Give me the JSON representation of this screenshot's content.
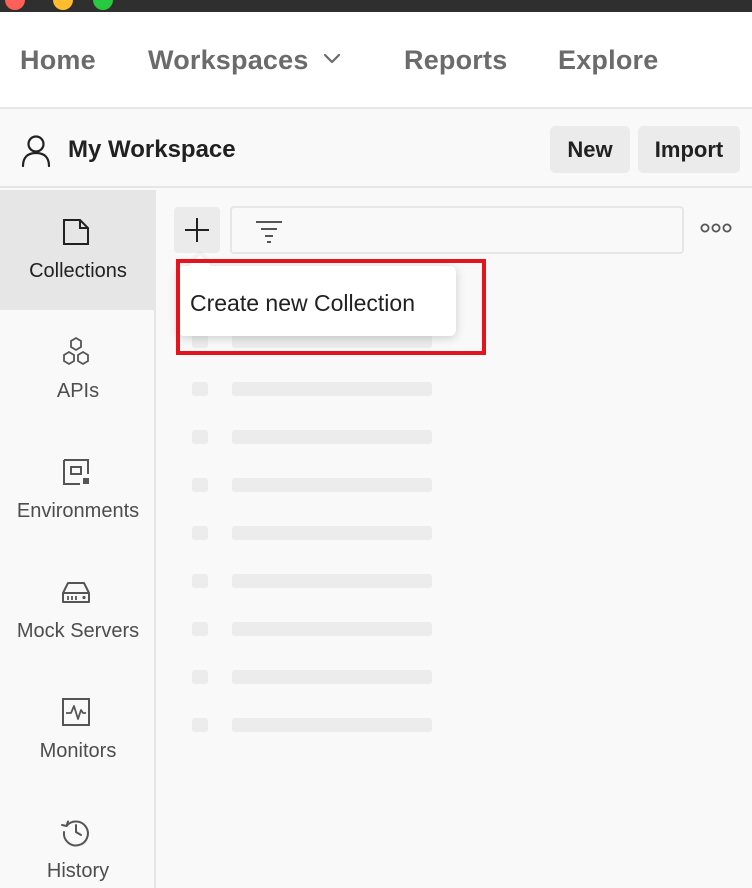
{
  "nav": {
    "home": "Home",
    "workspaces": "Workspaces",
    "reports": "Reports",
    "explore": "Explore"
  },
  "workspace": {
    "name": "My Workspace",
    "new_label": "New",
    "import_label": "Import"
  },
  "sidebar": {
    "items": [
      {
        "label": "Collections",
        "icon": "collections-icon",
        "active": true
      },
      {
        "label": "APIs",
        "icon": "apis-icon",
        "active": false
      },
      {
        "label": "Environments",
        "icon": "environments-icon",
        "active": false
      },
      {
        "label": "Mock Servers",
        "icon": "mock-servers-icon",
        "active": false
      },
      {
        "label": "Monitors",
        "icon": "monitors-icon",
        "active": false
      },
      {
        "label": "History",
        "icon": "history-icon",
        "active": false
      }
    ]
  },
  "tooltip": {
    "text": "Create new Collection"
  },
  "colors": {
    "highlight": "#e4141e",
    "active_sidebar": "#e6e6e6",
    "background": "#f9f9f9"
  }
}
